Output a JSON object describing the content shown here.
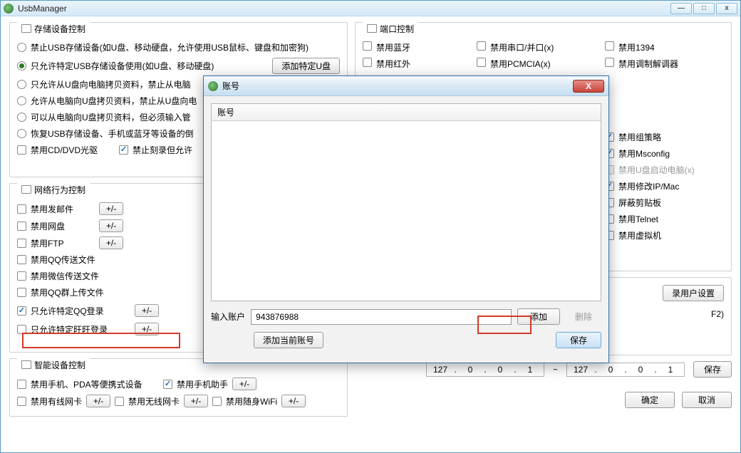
{
  "window": {
    "title": "UsbManager",
    "min": "—",
    "max": "□",
    "close": "x"
  },
  "groups": {
    "storage": "存储设备控制",
    "port": "端口控制",
    "network": "网络行为控制",
    "device": "智能设备控制"
  },
  "storage": {
    "r1": "禁止USB存储设备(如U盘、移动硬盘，允许使用USB鼠标、键盘和加密狗)",
    "r2": "只允许特定USB存储设备使用(如U盘、移动硬盘)",
    "r2btn": "添加特定U盘",
    "r3": "只允许从U盘向电脑拷贝资料，禁止从电脑",
    "r4": "允许从电脑向U盘拷贝资料，禁止从U盘向电",
    "r5": "可以从电脑向U盘拷贝资料，但必须输入管",
    "r6": "恢复USB存储设备、手机或蓝牙等设备的倒",
    "c1": "禁用CD/DVD光驱",
    "c2": "禁止刻录但允许"
  },
  "port": {
    "p1": "禁用蓝牙",
    "p2": "禁用串口/并口(x)",
    "p3": "禁用1394",
    "p4": "禁用红外",
    "p5": "禁用PCMCIA(x)",
    "p6": "禁用调制解调器",
    "pg1": "禁用组策略",
    "pg2": "禁用Msconfig",
    "pg3": "禁用U盘启动电脑(x)",
    "pg4": "禁用修改IP/Mac",
    "pg5": "屏蔽剪贴板",
    "pg6": "禁用Telnet",
    "pg7": "禁用虚拟机"
  },
  "network": {
    "n1": "禁用发邮件",
    "n2": "禁用网盘",
    "n3": "禁用FTP",
    "n4": "禁用QQ传送文件",
    "n5": "禁用微信传送文件",
    "n6": "禁用QQ群上传文件",
    "n7": "只允许特定QQ登录",
    "n8": "只允许特定旺旺登录",
    "pm": "+/-"
  },
  "device": {
    "d1": "禁用手机、PDA等便携式设备",
    "d2": "禁用手机助手",
    "d3": "禁用有线网卡",
    "d4": "禁用无线网卡",
    "d5": "禁用随身WiFi",
    "pm": "+/-"
  },
  "right_extra": {
    "user_settings": "录用户设置",
    "f2": "F2)",
    "ip1": [
      "127",
      "0",
      "0",
      "1"
    ],
    "ip2": [
      "127",
      "0",
      "0",
      "1"
    ],
    "dash": "~"
  },
  "bottom": {
    "save": "保存",
    "ok": "确定",
    "cancel": "取消"
  },
  "dialog": {
    "title": "账号",
    "list_header": "账号",
    "input_label": "输入账户",
    "input_value": "943876988",
    "add": "添加",
    "delete": "删除",
    "add_current": "添加当前账号",
    "save": "保存",
    "close": "X"
  }
}
